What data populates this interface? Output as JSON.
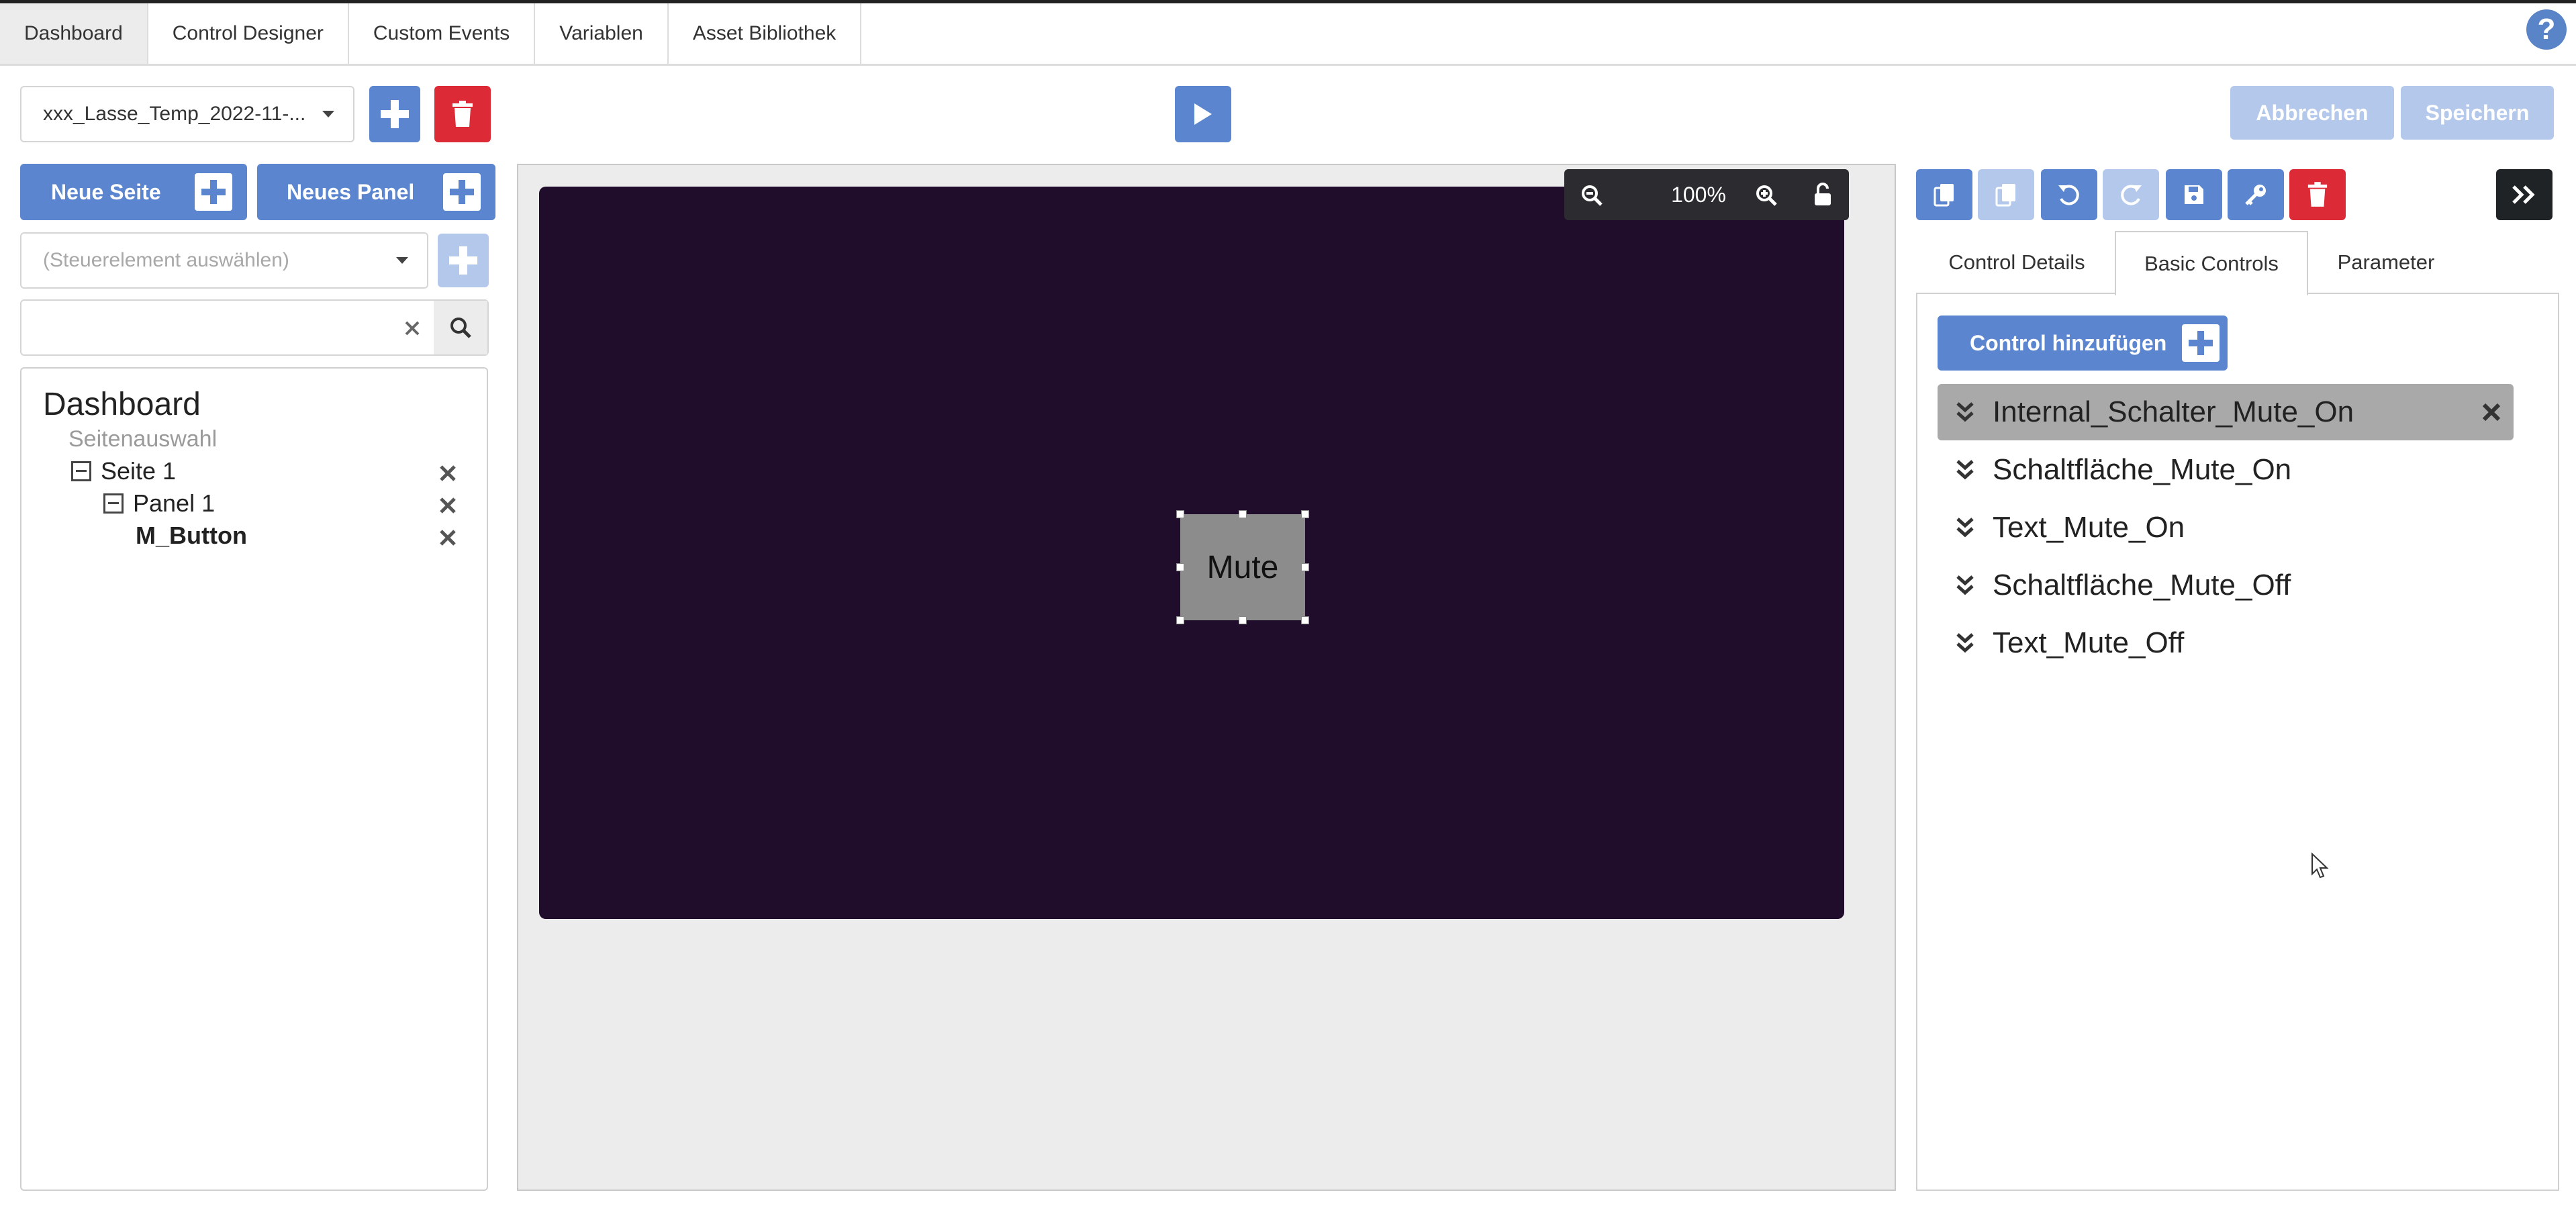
{
  "nav": {
    "tabs": [
      {
        "label": "Dashboard",
        "active": true
      },
      {
        "label": "Control Designer"
      },
      {
        "label": "Custom Events"
      },
      {
        "label": "Variablen"
      },
      {
        "label": "Asset Bibliothek"
      }
    ],
    "help_icon": "question-circle-icon"
  },
  "toolbar": {
    "project_select": "xxx_Lasse_Temp_2022-11-...",
    "cancel_label": "Abbrechen",
    "save_label": "Speichern"
  },
  "left": {
    "new_page_label": "Neue Seite",
    "new_panel_label": "Neues Panel",
    "control_select_placeholder": "(Steuerelement auswählen)",
    "search_value": "",
    "tree": {
      "title": "Dashboard",
      "subtitle": "Seitenauswahl",
      "page": "Seite 1",
      "panel": "Panel 1",
      "control": "M_Button"
    }
  },
  "canvas": {
    "zoom": "100%",
    "stage_color": "#200c2b",
    "button_label": "Mute"
  },
  "right": {
    "tabs": [
      {
        "label": "Control Details"
      },
      {
        "label": "Basic Controls",
        "active": true
      },
      {
        "label": "Parameter"
      }
    ],
    "add_control_label": "Control hinzufügen",
    "controls": [
      {
        "label": "Internal_Schalter_Mute_On",
        "selected": true
      },
      {
        "label": "Schaltfläche_Mute_On"
      },
      {
        "label": "Text_Mute_On"
      },
      {
        "label": "Schaltfläche_Mute_Off"
      },
      {
        "label": "Text_Mute_Off"
      }
    ]
  },
  "colors": {
    "primary": "#5b86cf",
    "primary_disabled": "#b3c8eb",
    "danger": "#dc2b36",
    "dark": "#202326"
  }
}
